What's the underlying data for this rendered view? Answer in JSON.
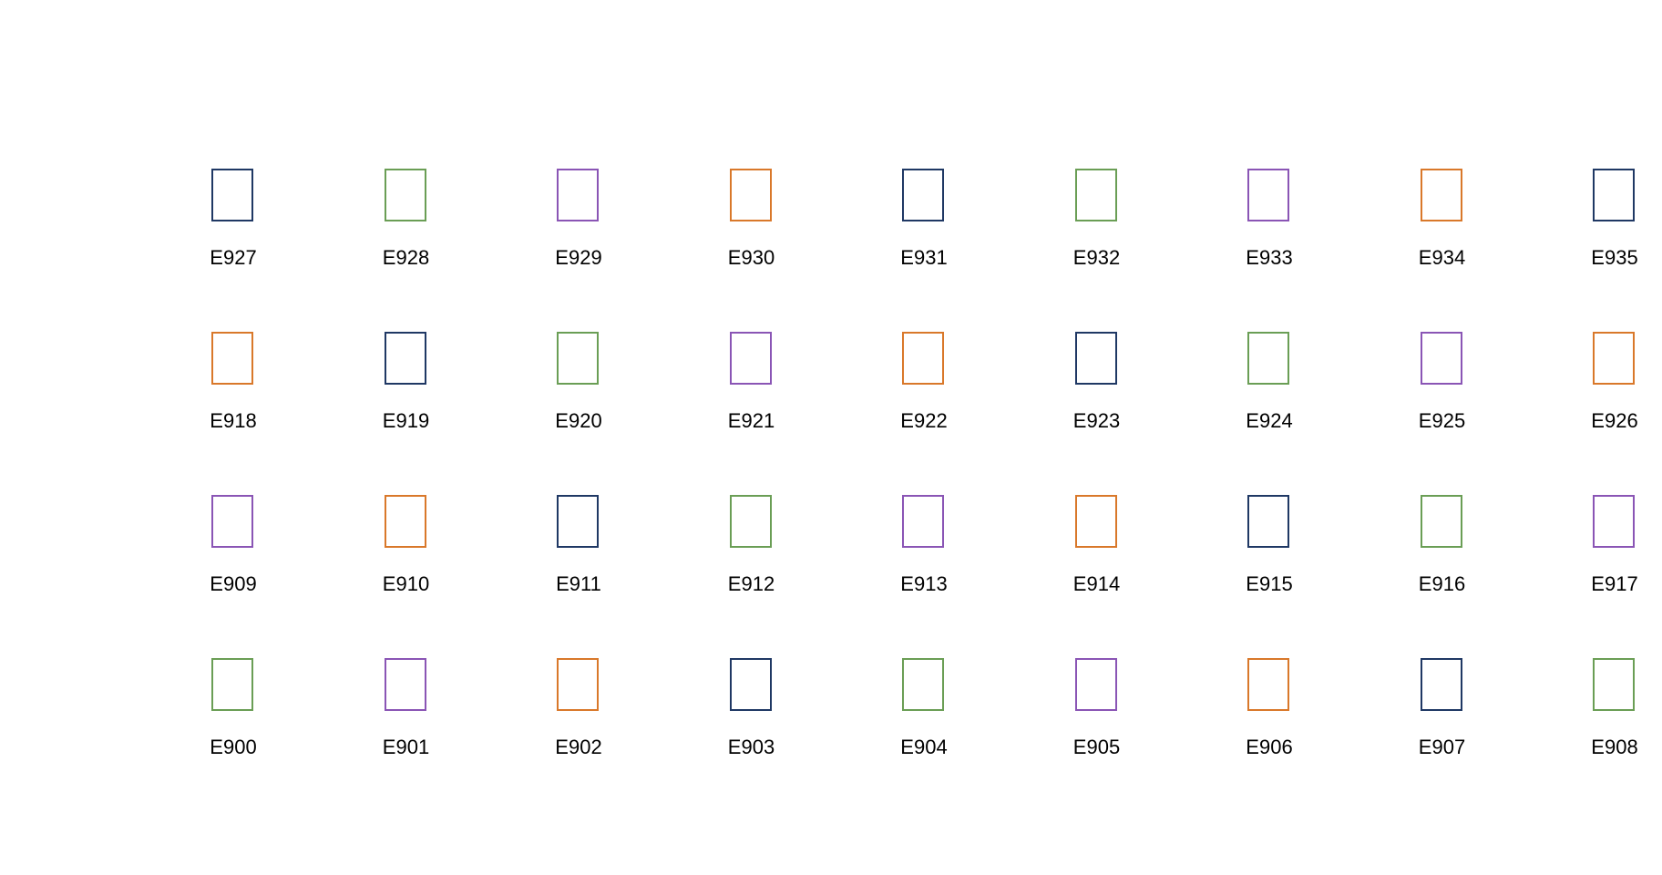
{
  "colors": {
    "navy": "#1f3864",
    "green": "#6a9e55",
    "purple": "#8a55b5",
    "orange": "#d9782a"
  },
  "rows": [
    [
      {
        "label": "E927",
        "color": "navy"
      },
      {
        "label": "E928",
        "color": "green"
      },
      {
        "label": "E929",
        "color": "purple"
      },
      {
        "label": "E930",
        "color": "orange"
      },
      {
        "label": "E931",
        "color": "navy"
      },
      {
        "label": "E932",
        "color": "green"
      },
      {
        "label": "E933",
        "color": "purple"
      },
      {
        "label": "E934",
        "color": "orange"
      },
      {
        "label": "E935",
        "color": "navy"
      }
    ],
    [
      {
        "label": "E918",
        "color": "orange"
      },
      {
        "label": "E919",
        "color": "navy"
      },
      {
        "label": "E920",
        "color": "green"
      },
      {
        "label": "E921",
        "color": "purple"
      },
      {
        "label": "E922",
        "color": "orange"
      },
      {
        "label": "E923",
        "color": "navy"
      },
      {
        "label": "E924",
        "color": "green"
      },
      {
        "label": "E925",
        "color": "purple"
      },
      {
        "label": "E926",
        "color": "orange"
      }
    ],
    [
      {
        "label": "E909",
        "color": "purple"
      },
      {
        "label": "E910",
        "color": "orange"
      },
      {
        "label": "E911",
        "color": "navy"
      },
      {
        "label": "E912",
        "color": "green"
      },
      {
        "label": "E913",
        "color": "purple"
      },
      {
        "label": "E914",
        "color": "orange"
      },
      {
        "label": "E915",
        "color": "navy"
      },
      {
        "label": "E916",
        "color": "green"
      },
      {
        "label": "E917",
        "color": "purple"
      }
    ],
    [
      {
        "label": "E900",
        "color": "green"
      },
      {
        "label": "E901",
        "color": "purple"
      },
      {
        "label": "E902",
        "color": "orange"
      },
      {
        "label": "E903",
        "color": "navy"
      },
      {
        "label": "E904",
        "color": "green"
      },
      {
        "label": "E905",
        "color": "purple"
      },
      {
        "label": "E906",
        "color": "orange"
      },
      {
        "label": "E907",
        "color": "navy"
      },
      {
        "label": "E908",
        "color": "green"
      }
    ]
  ]
}
